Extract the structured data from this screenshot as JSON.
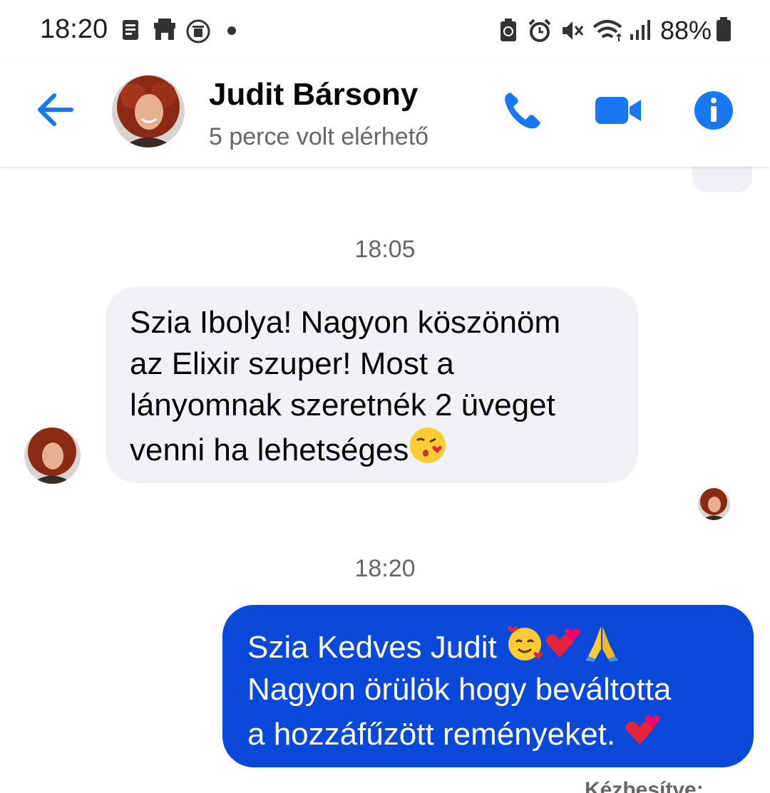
{
  "status_bar": {
    "time": "18:20",
    "battery": "88%",
    "left_icons": [
      "notes-icon",
      "store-icon",
      "cleaner-icon",
      "dot-icon"
    ],
    "right_icons": [
      "battery-saver-icon",
      "alarm-icon",
      "mute-icon",
      "wifi-icon",
      "signal-icon",
      "battery-icon"
    ]
  },
  "header": {
    "name": "Judit Bársony",
    "status": "5 perce volt elérhető",
    "accent": "#1877f2"
  },
  "messages": [
    {
      "timestamp": "18:05"
    },
    {
      "direction": "incoming",
      "text": "Szia Ibolya! Nagyon köszönöm\naz Elixir szuper! Most a\nlányomnak szeretnék 2 üveget\nvenni ha lehetséges",
      "emoji": "kissing-heart-emoji"
    },
    {
      "timestamp": "18:20"
    },
    {
      "direction": "outgoing",
      "line1": "Szia Kedves Judit ",
      "line2": "Nagyon örülök hogy beváltotta",
      "line3": "a hozzáfűzött reményeket. ",
      "emojis": [
        "smiling-hearts-emoji",
        "two-hearts-emoji",
        "praying-hands-emoji",
        "two-hearts-emoji"
      ]
    }
  ],
  "delivered_label": "Kézbesítve:",
  "colors": {
    "outgoing_bubble": "#0a48d9",
    "incoming_bubble": "#f0f2f5"
  }
}
